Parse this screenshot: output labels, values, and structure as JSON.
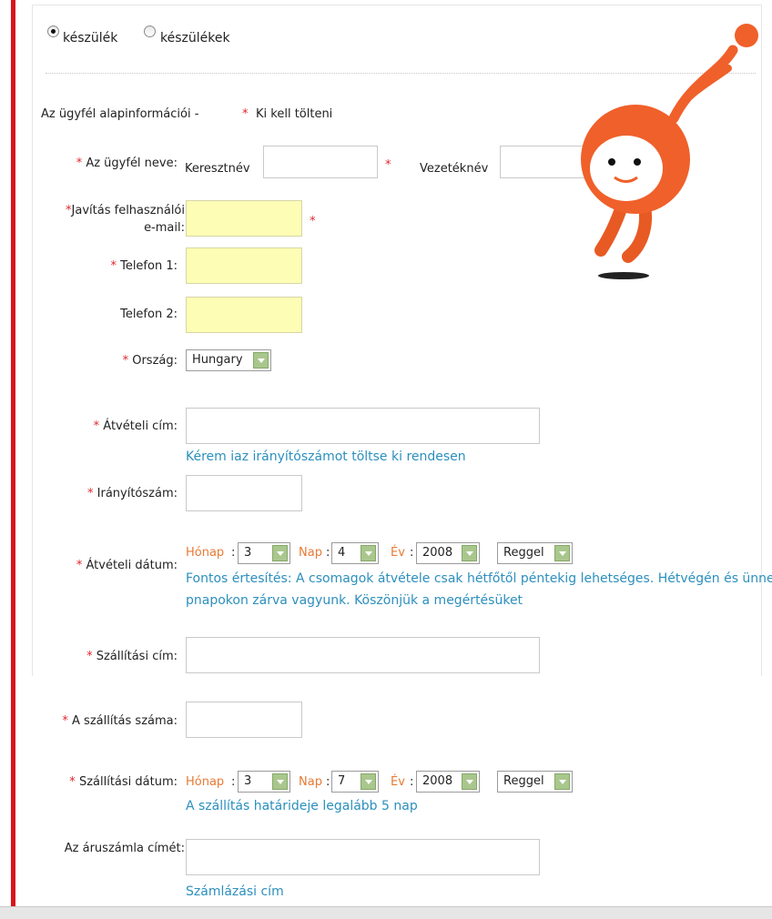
{
  "radios": [
    {
      "label": "készülék",
      "checked": true
    },
    {
      "label": "készülékek",
      "checked": false
    }
  ],
  "section_title": "Az ügyfél alapinformációi -",
  "required_note": "Ki kell tölteni",
  "star": "*",
  "name_row": {
    "label": "Az ügyfél neve:",
    "first_name_label": "Keresztnév",
    "last_name_label": "Vezetéknév",
    "first_name_value": "",
    "last_name_value": ""
  },
  "email": {
    "label_line1": "Javítás felhasználói",
    "label_line2": "e-mail:",
    "value": ""
  },
  "phone1": {
    "label": "Telefon 1:",
    "value": ""
  },
  "phone2": {
    "label": "Telefon 2:",
    "value": ""
  },
  "country": {
    "label": "Ország:",
    "selected": "Hungary"
  },
  "pickup_address": {
    "label": "Átvételi cím:",
    "value": "",
    "hint": "Kérem iaz irányítószámot töltse ki rendesen"
  },
  "zip": {
    "label": "Irányítószám:",
    "value": ""
  },
  "pickup_date": {
    "label": "Átvételi dátum:",
    "month_label": "Hónap",
    "month": "3",
    "day_label": "Nap",
    "day": "4",
    "year_label": "Év",
    "year": "2008",
    "time": "Reggel",
    "notice_line1": "Fontos értesítés: A csomagok átvétele csak hétfőtől péntekig lehetséges. Hétvégén és ünne",
    "notice_line2": "pnapokon zárva vagyunk. Köszönjük a megértésüket"
  },
  "delivery_address": {
    "label": "Szállítási cím:",
    "value": ""
  },
  "delivery_number": {
    "label": "A szállítás száma:",
    "value": ""
  },
  "delivery_date": {
    "label": "Szállítási dátum:",
    "month_label": "Hónap",
    "month": "3",
    "day_label": "Nap",
    "day": "7",
    "year_label": "Év",
    "year": "2008",
    "time": "Reggel",
    "hint": "A szállítás határideje legalább 5 nap"
  },
  "invoice": {
    "label": "Az áruszámla címét:",
    "value": "",
    "hint": "Számlázási cím"
  },
  "colors": {
    "accent_red": "#e0262c",
    "link_blue": "#2c8fbd",
    "orange": "#e77a35",
    "input_yellow": "#fefdb5",
    "mascot_orange": "#f0602a"
  },
  "mascot": "orange-runner-mascot"
}
